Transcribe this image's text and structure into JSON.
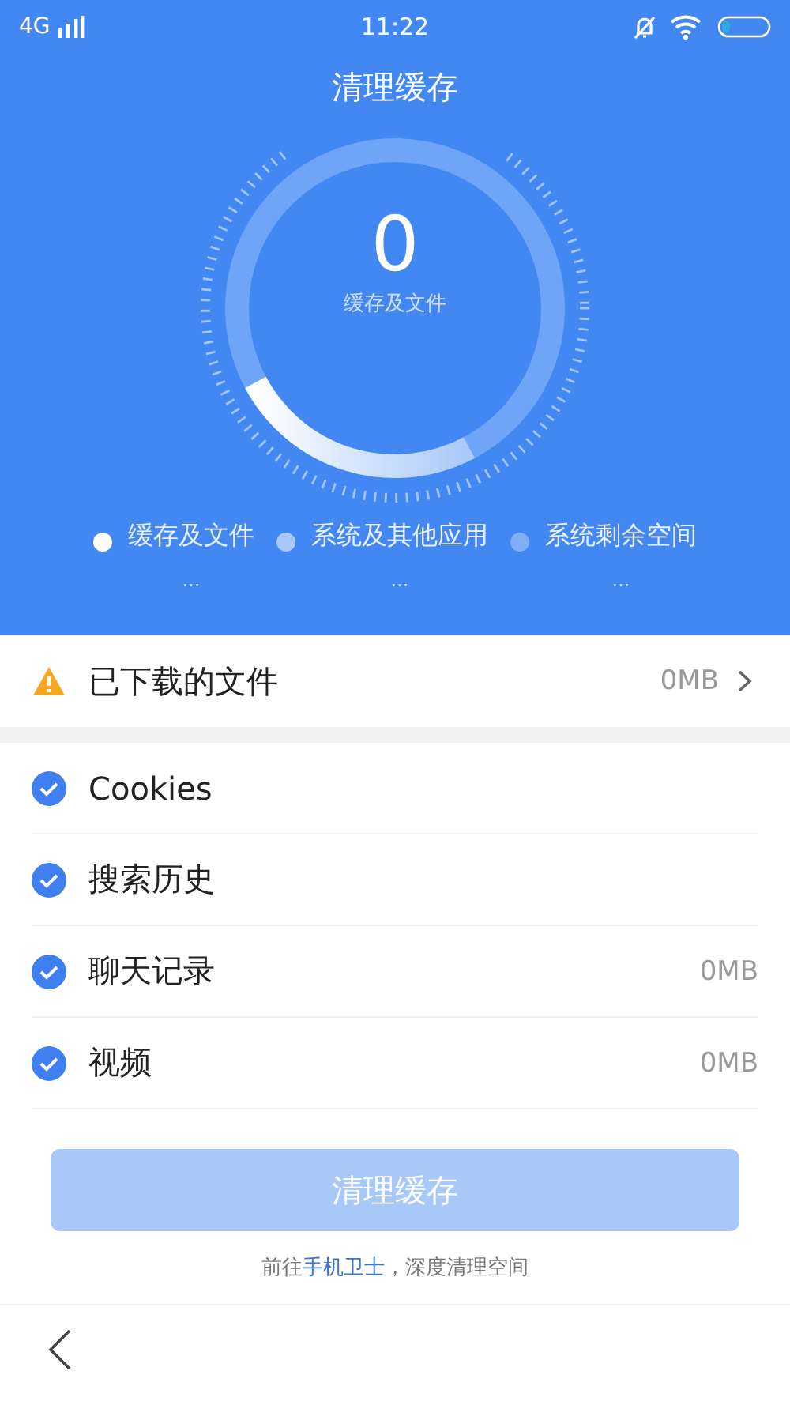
{
  "status_bar": {
    "network": "4G",
    "time": "11:22"
  },
  "header": {
    "title": "清理缓存",
    "ring": {
      "value": "0",
      "label": "缓存及文件"
    }
  },
  "legend": [
    {
      "label": "缓存及文件",
      "color": "#ffffff",
      "value": "..."
    },
    {
      "label": "系统及其他应用",
      "color": "#a9c8f8",
      "value": "..."
    },
    {
      "label": "系统剩余空间",
      "color": "#7eaef5",
      "value": "..."
    }
  ],
  "downloads": {
    "label": "已下载的文件",
    "size": "0MB"
  },
  "items": [
    {
      "label": "Cookies",
      "checked": true
    },
    {
      "label": "搜索历史",
      "checked": true
    },
    {
      "label": "聊天记录",
      "checked": true,
      "size": "0MB"
    },
    {
      "label": "视频",
      "checked": true,
      "size": "0MB"
    }
  ],
  "clean_button": {
    "label": "清理缓存",
    "disabled": true
  },
  "footer": {
    "before": "前往",
    "link": "手机卫士",
    "after": "，深度清理空间"
  }
}
